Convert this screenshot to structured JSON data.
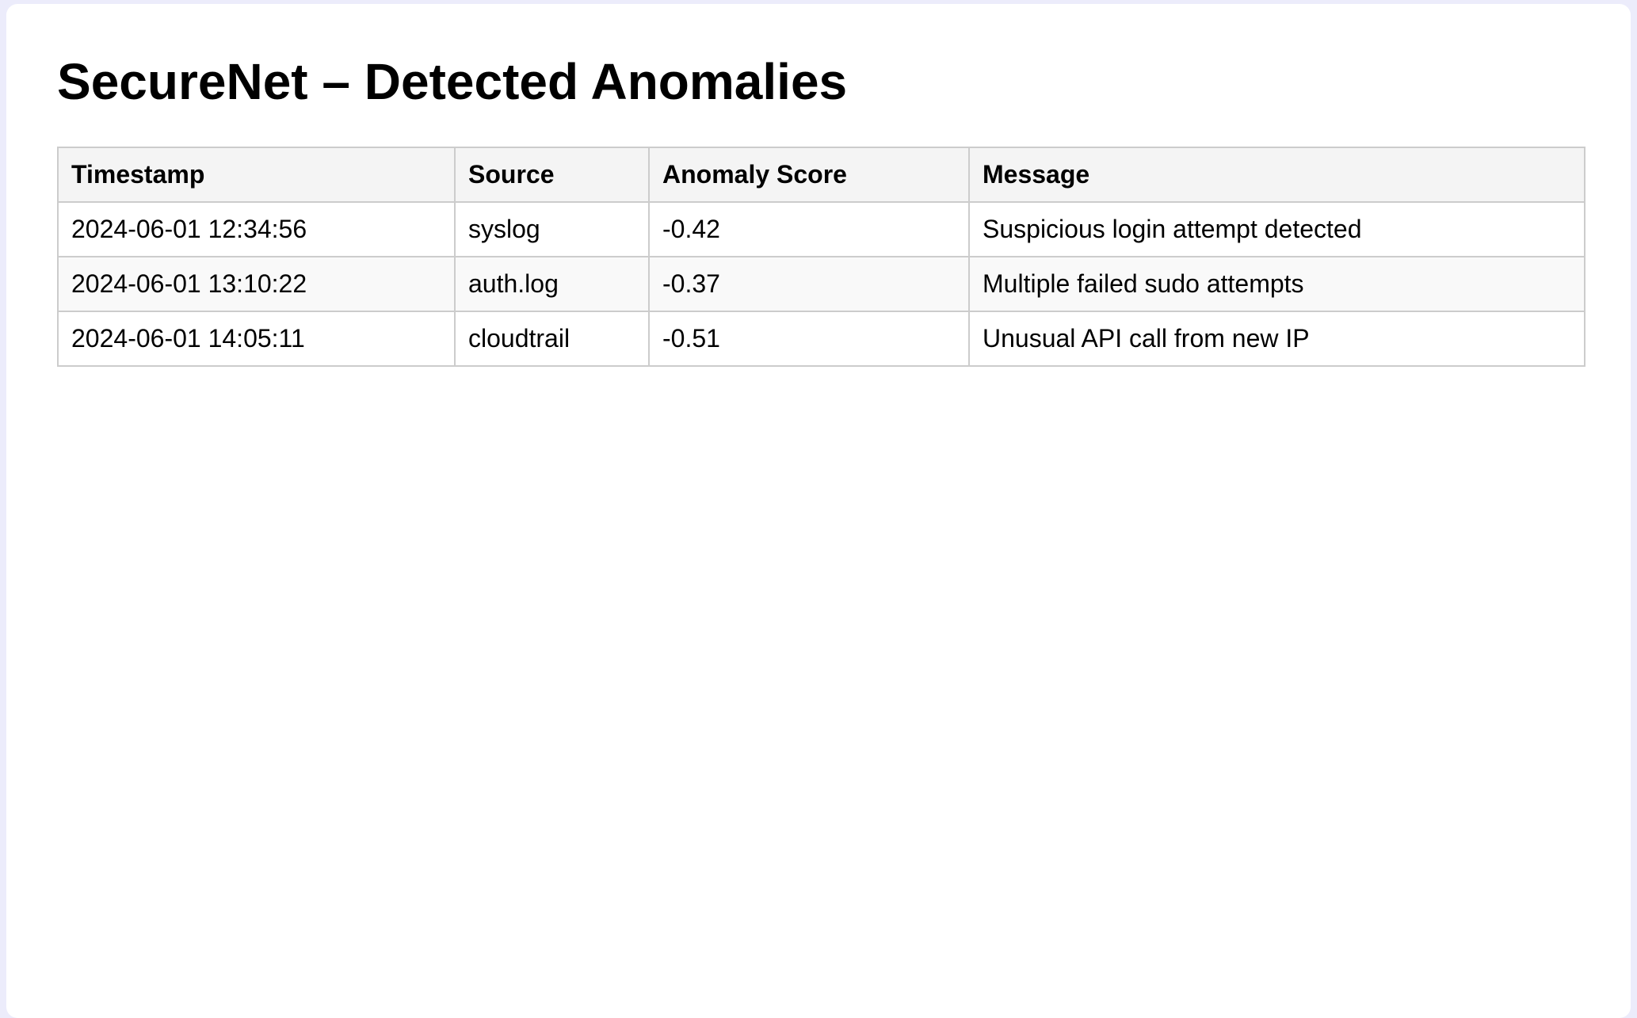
{
  "page": {
    "title": "SecureNet – Detected Anomalies"
  },
  "colors": {
    "background": "#ececfb",
    "card": "#ffffff",
    "header_row": "#f4f4f4",
    "striped_row": "#f9f9f9",
    "border": "#cccccc",
    "text": "#000000"
  },
  "table": {
    "headers": {
      "timestamp": "Timestamp",
      "source": "Source",
      "score": "Anomaly Score",
      "message": "Message"
    },
    "rows": [
      {
        "timestamp": "2024-06-01 12:34:56",
        "source": "syslog",
        "score": "-0.42",
        "message": "Suspicious login attempt detected"
      },
      {
        "timestamp": "2024-06-01 13:10:22",
        "source": "auth.log",
        "score": "-0.37",
        "message": "Multiple failed sudo attempts"
      },
      {
        "timestamp": "2024-06-01 14:05:11",
        "source": "cloudtrail",
        "score": "-0.51",
        "message": "Unusual API call from new IP"
      }
    ]
  }
}
